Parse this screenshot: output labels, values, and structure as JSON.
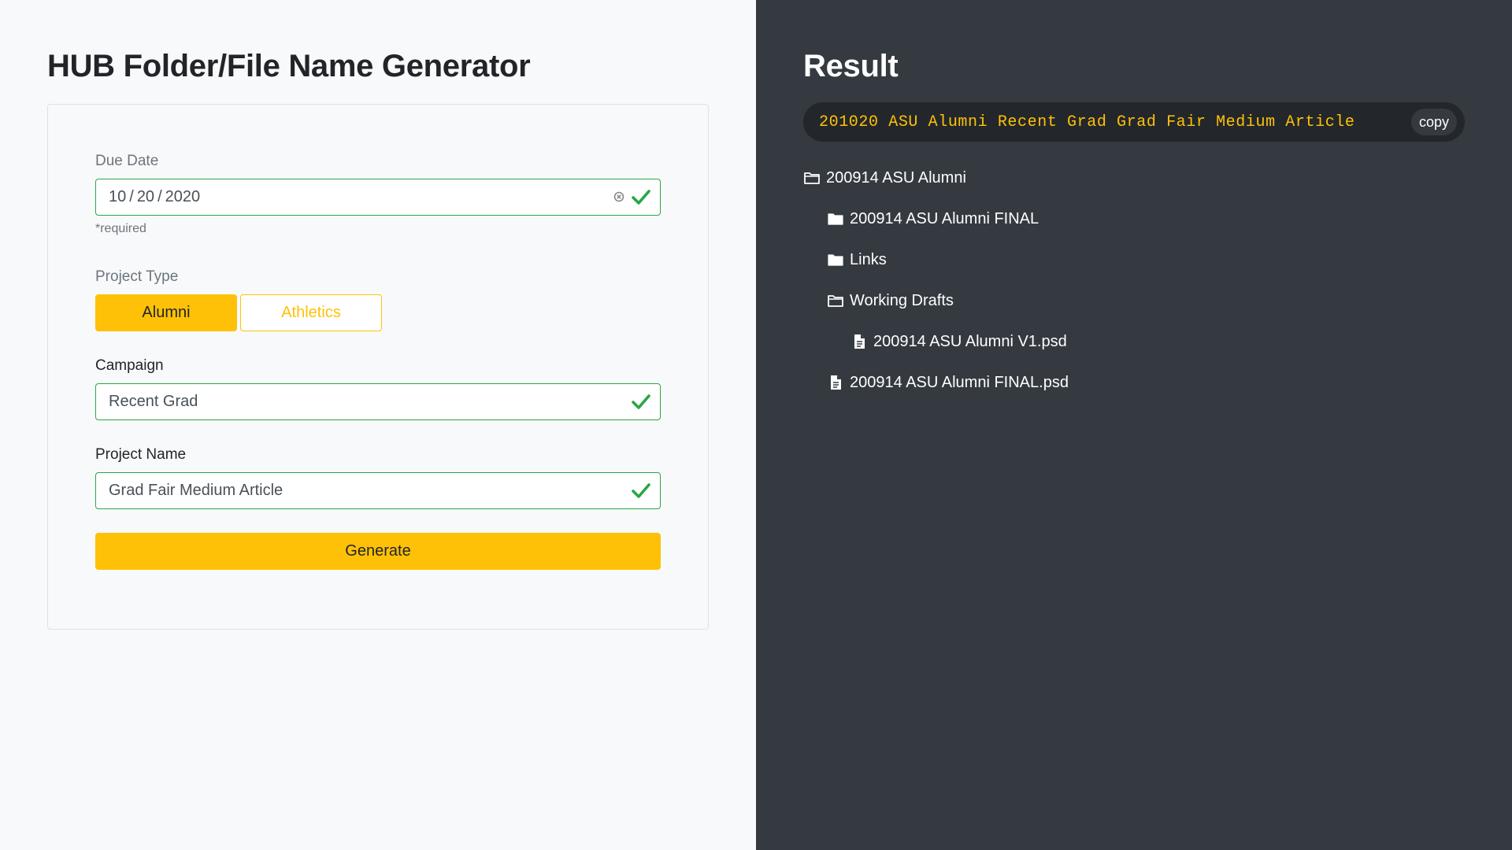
{
  "left": {
    "title": "HUB Folder/File Name Generator",
    "due_date": {
      "label": "Due Date",
      "month": "10",
      "day": "20",
      "year": "2020",
      "sep": "/",
      "help": "*required"
    },
    "project_type": {
      "label": "Project Type",
      "options": [
        "Alumni",
        "Athletics"
      ],
      "selected": "Alumni"
    },
    "campaign": {
      "label": "Campaign",
      "value": "Recent Grad"
    },
    "project_name": {
      "label": "Project Name",
      "value": "Grad Fair Medium Article"
    },
    "generate_label": "Generate"
  },
  "right": {
    "title": "Result",
    "result_text": "201020 ASU Alumni Recent Grad Grad Fair Medium Article",
    "copy_label": "copy",
    "tree": [
      {
        "label": "200914 ASU Alumni",
        "icon": "folder-open-icon"
      },
      {
        "label": "200914 ASU Alumni FINAL",
        "icon": "folder-icon"
      },
      {
        "label": "Links",
        "icon": "folder-icon"
      },
      {
        "label": "Working Drafts",
        "icon": "folder-open-icon"
      },
      {
        "label": "200914 ASU Alumni V1.psd",
        "icon": "file-icon"
      },
      {
        "label": "200914 ASU Alumni FINAL.psd",
        "icon": "file-icon"
      }
    ]
  },
  "colors": {
    "accent": "#ffc107",
    "valid": "#28a745",
    "dark_panel": "#343a40",
    "result_bg": "#23272b"
  }
}
